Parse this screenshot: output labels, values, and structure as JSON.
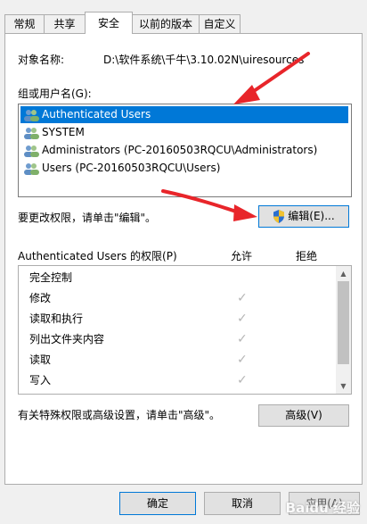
{
  "tabs": [
    {
      "label": "常规"
    },
    {
      "label": "共享"
    },
    {
      "label": "安全"
    },
    {
      "label": "以前的版本"
    },
    {
      "label": "自定义"
    }
  ],
  "object_name": {
    "label": "对象名称:",
    "value": "D:\\软件系统\\千牛\\3.10.02N\\uiresources"
  },
  "group_list": {
    "label": "组或用户名(G):",
    "items": [
      {
        "label": "Authenticated Users",
        "selected": true
      },
      {
        "label": "SYSTEM",
        "selected": false
      },
      {
        "label": "Administrators (PC-20160503RQCU\\Administrators)",
        "selected": false
      },
      {
        "label": "Users (PC-20160503RQCU\\Users)",
        "selected": false
      }
    ]
  },
  "edit_hint": "要更改权限，请单击\"编辑\"。",
  "edit_button": "编辑(E)...",
  "permissions": {
    "title": "Authenticated Users 的权限(P)",
    "allow_header": "允许",
    "deny_header": "拒绝",
    "rows": [
      {
        "name": "完全控制",
        "allow": false,
        "deny": false
      },
      {
        "name": "修改",
        "allow": true,
        "deny": false
      },
      {
        "name": "读取和执行",
        "allow": true,
        "deny": false
      },
      {
        "name": "列出文件夹内容",
        "allow": true,
        "deny": false
      },
      {
        "name": "读取",
        "allow": true,
        "deny": false
      },
      {
        "name": "写入",
        "allow": true,
        "deny": false
      }
    ]
  },
  "advanced_hint": "有关特殊权限或高级设置，请单击\"高级\"。",
  "advanced_button": "高级(V)",
  "footer": {
    "ok": "确定",
    "cancel": "取消",
    "apply": "应用(A)"
  },
  "watermark": "Baidu 经验",
  "colors": {
    "selection": "#0078d7",
    "arrow": "#e8252a",
    "check": "#b5b5b5"
  }
}
